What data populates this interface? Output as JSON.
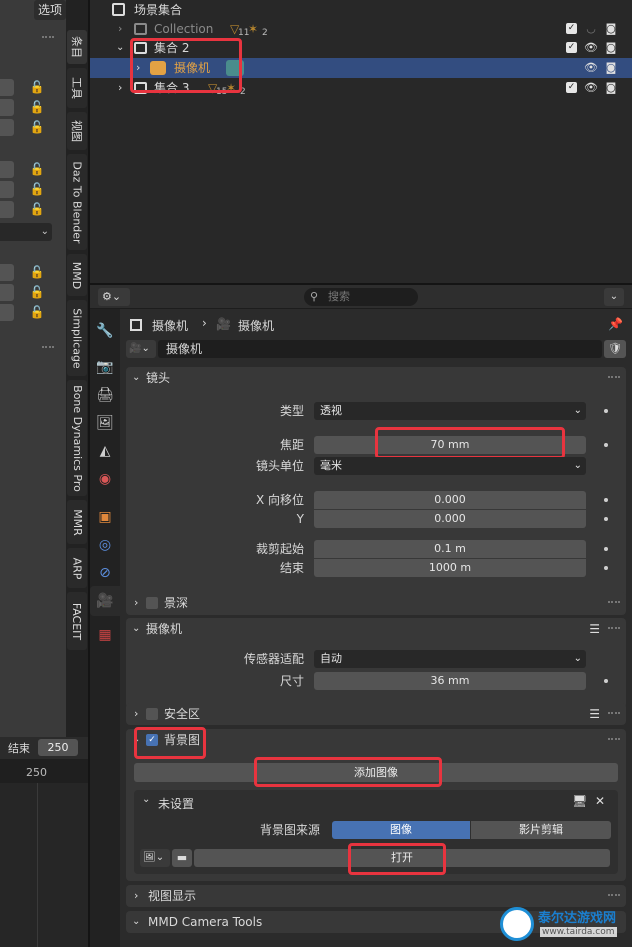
{
  "left_panel": {
    "options_label": "选项",
    "tabs": [
      "条目",
      "工具",
      "视图",
      "Daz To Blender",
      "MMD",
      "Simplicage",
      "Bone Dynamics Pro",
      "MMR",
      "ARP",
      "FACEIT"
    ],
    "timeline": {
      "end_label": "结束",
      "end_value": "250",
      "ruler_value": "250"
    }
  },
  "outliner": {
    "rows": [
      {
        "label": "场景集合"
      },
      {
        "label": "Collection",
        "badge1": "11",
        "badge2": "2"
      },
      {
        "label": "集合 2"
      },
      {
        "label": "摄像机"
      },
      {
        "label": "集合 3",
        "badge1": "15",
        "badge2": "2"
      }
    ]
  },
  "properties": {
    "search_placeholder": "搜索",
    "breadcrumb": {
      "object": "摄像机",
      "data": "摄像机"
    },
    "datablock_name": "摄像机",
    "lens": {
      "title": "镜头",
      "type_label": "类型",
      "type_value": "透视",
      "focal_label": "焦距",
      "focal_value": "70 mm",
      "unit_label": "镜头单位",
      "unit_value": "毫米",
      "shiftx_label": "X 向移位",
      "shiftx_value": "0.000",
      "shifty_label": "Y",
      "shifty_value": "0.000",
      "clip_start_label": "裁剪起始",
      "clip_start_value": "0.1 m",
      "clip_end_label": "结束",
      "clip_end_value": "1000 m"
    },
    "dof": {
      "title": "景深"
    },
    "camera": {
      "title": "摄像机",
      "fit_label": "传感器适配",
      "fit_value": "自动",
      "size_label": "尺寸",
      "size_value": "36 mm"
    },
    "safe_areas": {
      "title": "安全区"
    },
    "background": {
      "title": "背景图",
      "add_image": "添加图像",
      "unset_title": "未设置",
      "source_label": "背景图来源",
      "source_options": [
        "图像",
        "影片剪辑"
      ],
      "open_label": "打开"
    },
    "viewport_display": {
      "title": "视图显示"
    },
    "mmd_camera_tools": {
      "title": "MMD Camera Tools"
    }
  },
  "watermark": {
    "title": "泰尔达游戏网",
    "url": "www.tairda.com"
  },
  "colors": {
    "accent": "#4772b3",
    "highlight_red": "#e8343f",
    "selected_row": "#334d80",
    "camera_orange": "#e3a244"
  }
}
